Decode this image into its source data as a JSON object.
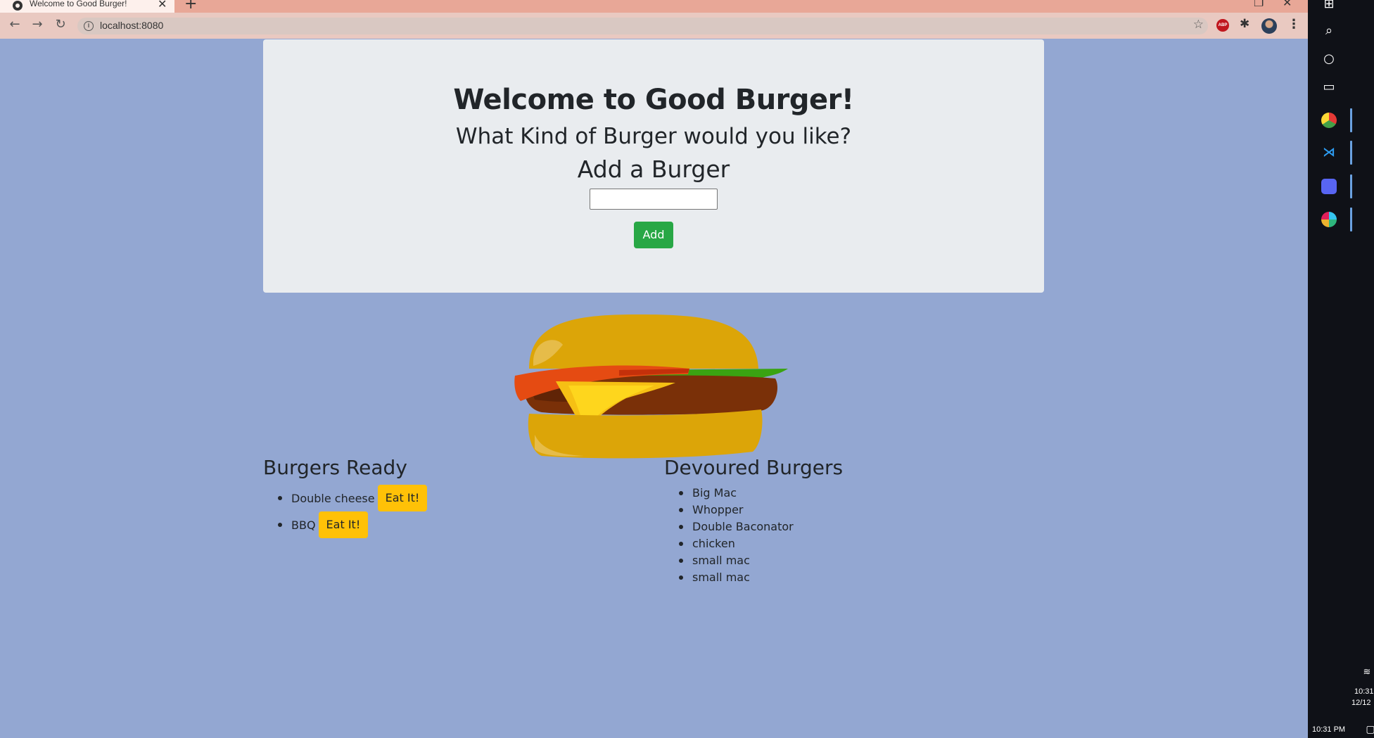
{
  "browser": {
    "tab_title": "Welcome to Good Burger!",
    "url": "localhost:8080",
    "tab_close": "✕",
    "new_tab": "+",
    "back": "←",
    "forward": "→",
    "reload": "↻",
    "star": "☆",
    "adblock_label": "ABP",
    "extensions": "✱",
    "menu": "⋮"
  },
  "page": {
    "title": "Welcome to Good Burger!",
    "subtitle": "What Kind of Burger would you like?",
    "form_heading": "Add a Burger",
    "burger_input_value": "",
    "add_button": "Add"
  },
  "ready": {
    "title": "Burgers Ready",
    "button_label": "Eat It!",
    "items": [
      "Double cheese",
      "BBQ"
    ]
  },
  "devoured": {
    "title": "Devoured Burgers",
    "items": [
      "Big Mac",
      "Whopper",
      "Double Baconator",
      "chicken",
      "small mac",
      "small mac"
    ]
  },
  "taskbar": {
    "clock": "10:31 PM",
    "side_time": "10:31",
    "side_date": "12/12"
  },
  "colors": {
    "page_background": "#93a7d2",
    "jumbotron": "#e9ecef",
    "add_button": "#28a745",
    "eat_button": "#ffc107"
  }
}
